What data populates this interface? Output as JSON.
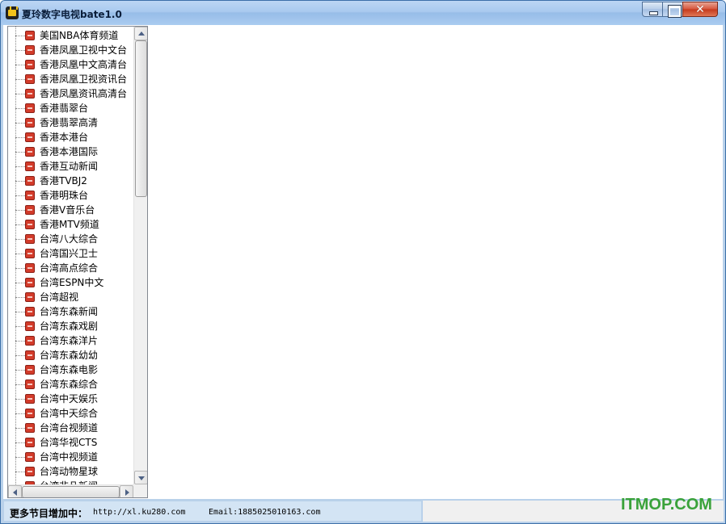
{
  "window": {
    "title": "夏玲数字电视bate1.0"
  },
  "channels": [
    "美国NBA体育频道",
    "香港凤凰卫视中文台",
    "香港凤凰中文高清台",
    "香港凤凰卫视资讯台",
    "香港凤凰资讯高清台",
    "香港翡翠台",
    "香港翡翠高清",
    "香港本港台",
    "香港本港国际",
    "香港互动新闻",
    "香港TVBJ2",
    "香港明珠台",
    "香港V音乐台",
    "香港MTV频道",
    "台湾八大综合",
    "台湾国兴卫士",
    "台湾高点综合",
    "台湾ESPN中文",
    "台湾超视",
    "台湾东森新闻",
    "台湾东森戏剧",
    "台湾东森洋片",
    "台湾东森幼幼",
    "台湾东森电影",
    "台湾东森综合",
    "台湾中天娱乐",
    "台湾中天综合",
    "台湾台视频道",
    "台湾华视CTS",
    "台湾中视频道",
    "台湾动物星球",
    "台湾非凡新闻"
  ],
  "status": {
    "label": "更多节目增加中：",
    "url": "http://xl.ku280.com",
    "email": "Email:1885025010163.com"
  },
  "watermark": "ITMOP.COM",
  "colors": {
    "titlebar": "#a9c9ef",
    "status_bg": "#d3e4f4",
    "channel_icon": "#d33b2a",
    "watermark": "#3aa23a"
  }
}
